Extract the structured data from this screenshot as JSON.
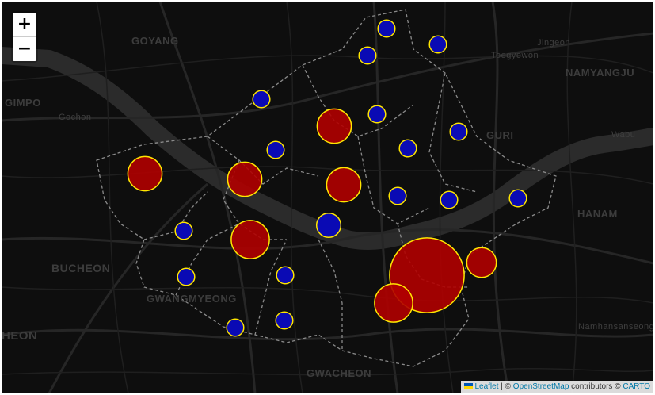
{
  "map": {
    "place_labels": [
      {
        "text": "GOYANG",
        "kind": "city"
      },
      {
        "text": "GIMPO",
        "kind": "city"
      },
      {
        "text": "Gochon",
        "kind": "town"
      },
      {
        "text": "Jingeon",
        "kind": "town"
      },
      {
        "text": "Toegyewon",
        "kind": "town"
      },
      {
        "text": "NAMYANGJU",
        "kind": "city"
      },
      {
        "text": "GURI",
        "kind": "city"
      },
      {
        "text": "Wabu",
        "kind": "town"
      },
      {
        "text": "HANAM",
        "kind": "city"
      },
      {
        "text": "BUCHEON",
        "kind": "city"
      },
      {
        "text": "GWANGMYEONG",
        "kind": "city"
      },
      {
        "text": "HEON",
        "kind": "city"
      },
      {
        "text": "GWACHEON",
        "kind": "city"
      },
      {
        "text": "Namhansanseong",
        "kind": "town"
      }
    ],
    "markers": [
      {
        "value": 4,
        "color": "#b00000"
      },
      {
        "value": 4,
        "color": "#b00000"
      },
      {
        "value": 5,
        "color": "#b00000"
      },
      {
        "value": 4,
        "color": "#b00000"
      },
      {
        "value": 4,
        "color": "#b00000"
      },
      {
        "value": 19,
        "color": "#b00000"
      },
      {
        "value": 3,
        "color": "#b00000"
      },
      {
        "value": 5,
        "color": "#b00000"
      },
      {
        "value": 1,
        "color": "#0a0ab4"
      },
      {
        "value": 1,
        "color": "#0a0ab4"
      },
      {
        "value": 1,
        "color": "#0a0ab4"
      },
      {
        "value": 1,
        "color": "#0a0ab4"
      },
      {
        "value": 1,
        "color": "#0a0ab4"
      },
      {
        "value": 1,
        "color": "#0a0ab4"
      },
      {
        "value": 1,
        "color": "#0a0ab4"
      },
      {
        "value": 1,
        "color": "#0a0ab4"
      },
      {
        "value": 2,
        "color": "#0a0ab4"
      },
      {
        "value": 1,
        "color": "#0a0ab4"
      },
      {
        "value": 1,
        "color": "#0a0ab4"
      },
      {
        "value": 1,
        "color": "#0a0ab4"
      },
      {
        "value": 1,
        "color": "#0a0ab4"
      },
      {
        "value": 1,
        "color": "#0a0ab4"
      },
      {
        "value": 1,
        "color": "#0a0ab4"
      },
      {
        "value": 1,
        "color": "#0a0ab4"
      },
      {
        "value": 1,
        "color": "#0a0ab4"
      }
    ],
    "marker_stroke_color": "#ffe600"
  },
  "zoom": {
    "in_label": "+",
    "out_label": "−"
  },
  "attribution": {
    "leaflet": "Leaflet",
    "sep": " | © ",
    "osm": "OpenStreetMap",
    "contrib": " contributors © ",
    "carto": "CARTO"
  }
}
